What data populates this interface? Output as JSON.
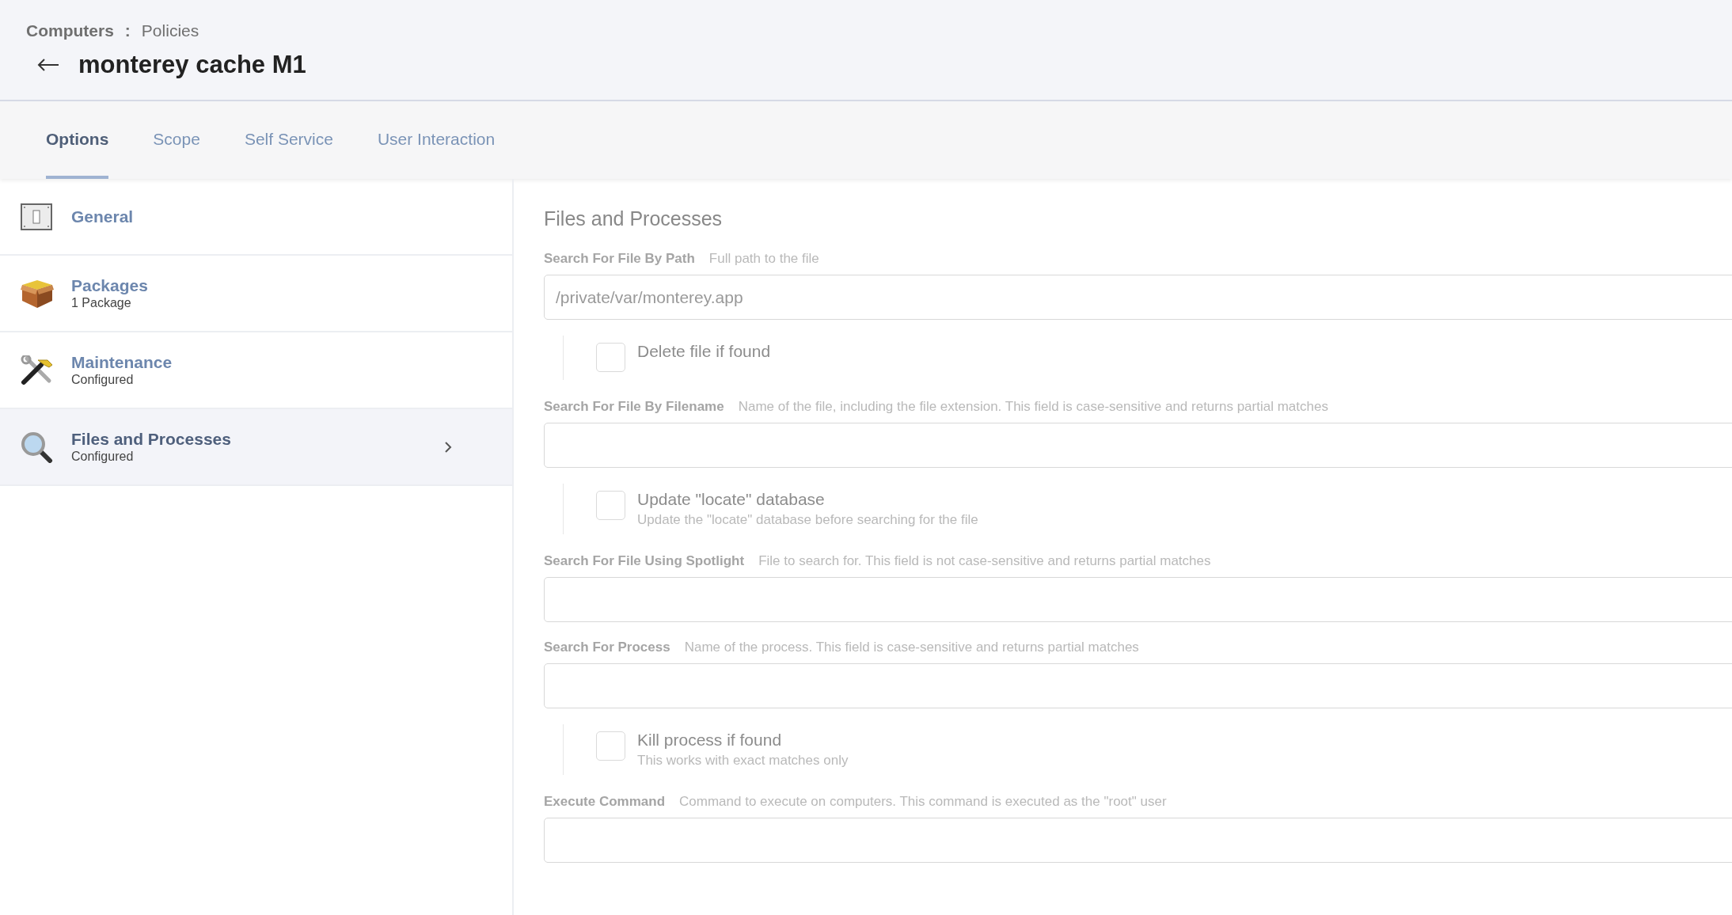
{
  "breadcrumb": {
    "parent": "Computers",
    "separator": ":",
    "current": "Policies"
  },
  "page_title": "monterey cache M1",
  "tabs": [
    {
      "label": "Options",
      "selected": true
    },
    {
      "label": "Scope",
      "selected": false
    },
    {
      "label": "Self Service",
      "selected": false
    },
    {
      "label": "User Interaction",
      "selected": false
    }
  ],
  "sidebar": {
    "items": [
      {
        "kind": "switch",
        "title": "General",
        "selected": false
      },
      {
        "kind": "package",
        "title": "Packages",
        "subtitle": "1 Package",
        "selected": false
      },
      {
        "kind": "tools",
        "title": "Maintenance",
        "subtitle": "Configured",
        "selected": false
      },
      {
        "kind": "magnifier",
        "title": "Files and Processes",
        "subtitle": "Configured",
        "selected": true
      }
    ]
  },
  "panel": {
    "heading": "Files and Processes",
    "rows": [
      {
        "kind": "field",
        "label": "Search For File By Path",
        "hint": "Full path to the file",
        "value": "/private/var/monterey.app"
      },
      {
        "kind": "checkbox",
        "label": "Delete file if found",
        "checked": false
      },
      {
        "kind": "field",
        "label": "Search For File By Filename",
        "hint": "Name of the file, including the file extension. This field is case-sensitive and returns partial matches"
      },
      {
        "kind": "checkbox",
        "label": "Update \"locate\" database",
        "sublabel": "Update the \"locate\" database before searching for the file",
        "checked": false
      },
      {
        "kind": "field",
        "label": "Search For File Using Spotlight",
        "hint": "File to search for. This field is not case-sensitive and returns partial matches"
      },
      {
        "kind": "field",
        "label": "Search For Process",
        "hint": "Name of the process. This field is case-sensitive and returns partial matches"
      },
      {
        "kind": "checkbox",
        "label": "Kill process if found",
        "sublabel": "This works with exact matches only",
        "checked": false
      },
      {
        "kind": "field",
        "label": "Execute Command",
        "hint": "Command to execute on computers. This command is executed as the \"root\" user"
      }
    ]
  }
}
